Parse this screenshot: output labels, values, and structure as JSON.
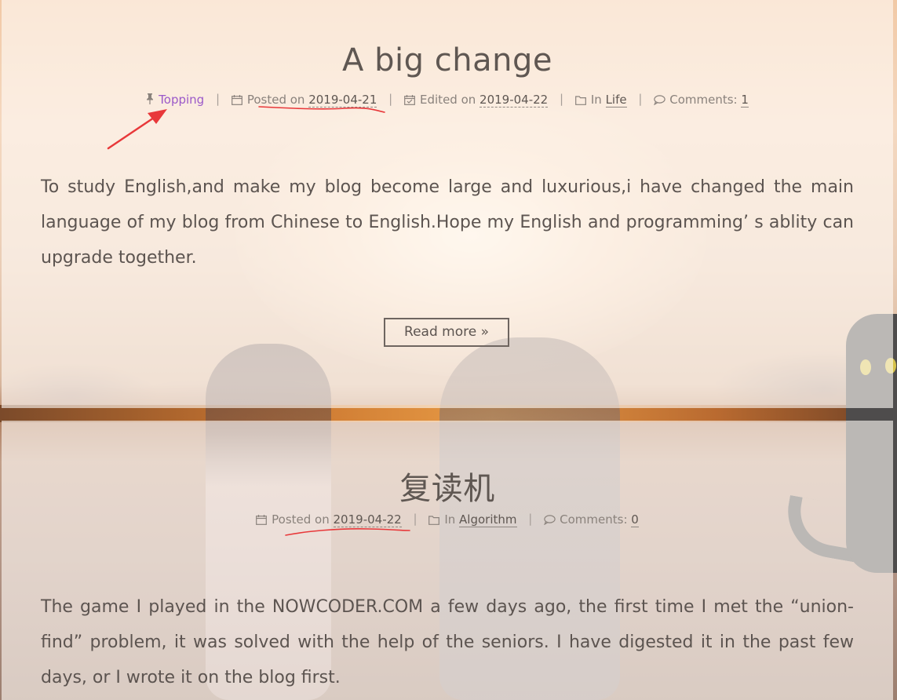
{
  "posts": [
    {
      "title": "A big change",
      "pinned_label": "Topping",
      "posted_prefix": "Posted on",
      "posted_date": "2019-04-21",
      "edited_prefix": "Edited on",
      "edited_date": "2019-04-22",
      "category_prefix": "In",
      "category": "Life",
      "comments_prefix": "Comments:",
      "comments_count": "1",
      "excerpt": "To study English,and make my blog become large and luxurious,i have changed the main language of my blog from Chinese to English.Hope my English and programming’ s ablity can upgrade together.",
      "read_more": "Read more »"
    },
    {
      "title": "复读机",
      "posted_prefix": "Posted on",
      "posted_date": "2019-04-22",
      "category_prefix": "In",
      "category": "Algorithm",
      "comments_prefix": "Comments:",
      "comments_count": "0",
      "excerpt": "The game I played in the NOWCODER.COM a few days ago, the first time I met the “union-find” problem, it was solved with the help of the seniors. I have digested it in the past few days, or I wrote it on the blog first."
    }
  ],
  "colors": {
    "text": "#5c5450",
    "meta": "#8a827c",
    "topping": "#9b59c9",
    "annotation": "#e8383a"
  },
  "icons": [
    "pin-icon",
    "calendar-icon",
    "calendar-check-icon",
    "folder-icon",
    "comment-icon"
  ]
}
